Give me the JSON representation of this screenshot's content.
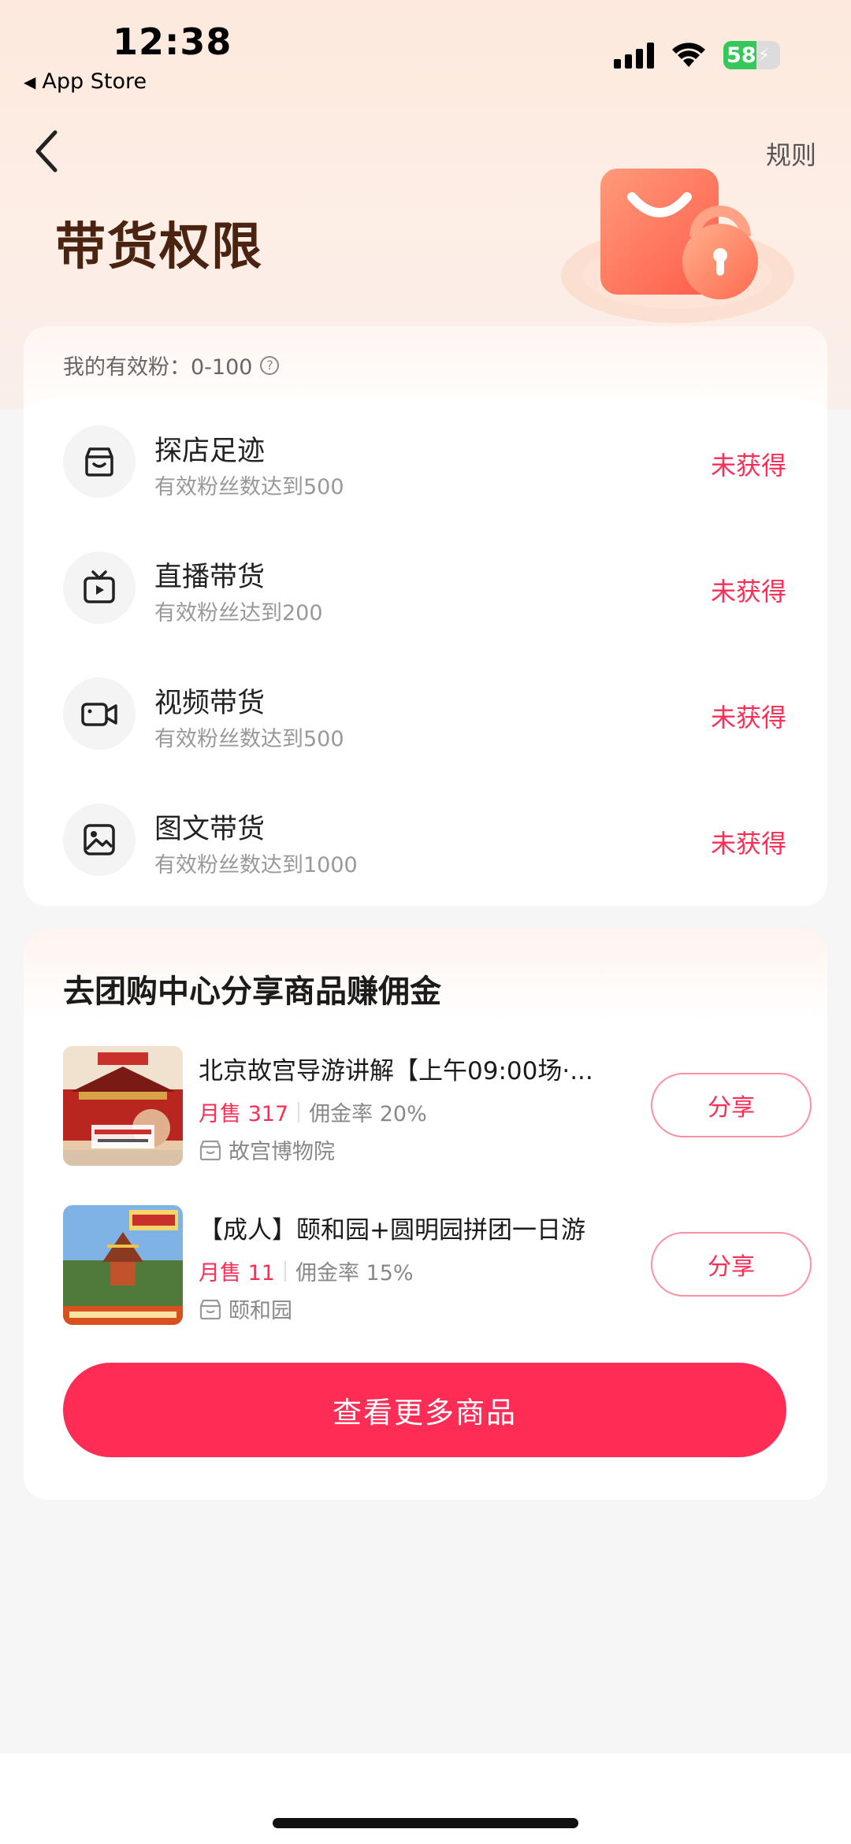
{
  "status_bar": {
    "time": "12:38",
    "back_app": "App Store",
    "battery": "58"
  },
  "header": {
    "title": "带货权限",
    "rules": "规则"
  },
  "permissions": {
    "fans_label": "我的有效粉：0-100",
    "help_glyph": "?",
    "items": [
      {
        "icon": "store-icon",
        "name": "探店足迹",
        "desc": "有效粉丝数达到500",
        "status": "未获得"
      },
      {
        "icon": "live-tv-icon",
        "name": "直播带货",
        "desc": "有效粉丝达到200",
        "status": "未获得"
      },
      {
        "icon": "video-camera-icon",
        "name": "视频带货",
        "desc": "有效粉丝数达到500",
        "status": "未获得"
      },
      {
        "icon": "image-icon",
        "name": "图文带货",
        "desc": "有效粉丝数达到1000",
        "status": "未获得"
      }
    ]
  },
  "group_buy": {
    "title": "去团购中心分享商品赚佣金",
    "products": [
      {
        "title": "北京故宫导游讲解【上午09:00场·...",
        "sold": "月售 317",
        "rate": "佣金率 20%",
        "shop": "故宫博物院",
        "share": "分享"
      },
      {
        "title": "【成人】颐和园+圆明园拼团一日游",
        "sold": "月售 11",
        "rate": "佣金率 15%",
        "shop": "颐和园",
        "share": "分享"
      }
    ],
    "more_button": "查看更多商品"
  },
  "colors": {
    "accent": "#ff2d55",
    "title_brown": "#4a2410",
    "battery_green": "#35c759"
  }
}
